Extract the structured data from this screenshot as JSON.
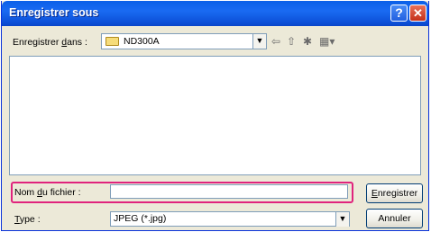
{
  "window": {
    "title": "Enregistrer sous",
    "help_glyph": "?",
    "close_glyph": "✕"
  },
  "location": {
    "label_prefix": "Enregistrer ",
    "label_accel": "d",
    "label_suffix": "ans :",
    "folder_name": "ND300A",
    "dropdown_glyph": "▼"
  },
  "toolbar": {
    "back_glyph": "⇦",
    "up_glyph": "⇧",
    "new_folder_glyph": "✱",
    "view_glyph": "▦▾"
  },
  "file_name": {
    "label_prefix": "Nom ",
    "label_accel": "d",
    "label_suffix": "u fichier :",
    "value": ""
  },
  "file_type": {
    "label_accel": "T",
    "label_suffix": "ype :",
    "value": "JPEG (*.jpg)",
    "dropdown_glyph": "▼"
  },
  "buttons": {
    "save_accel": "E",
    "save_suffix": "nregistrer",
    "cancel": "Annuler"
  },
  "colors": {
    "title_bar": "#0a5fe8",
    "highlight_frame": "#e0237d",
    "dialog_face": "#ece9d8"
  }
}
